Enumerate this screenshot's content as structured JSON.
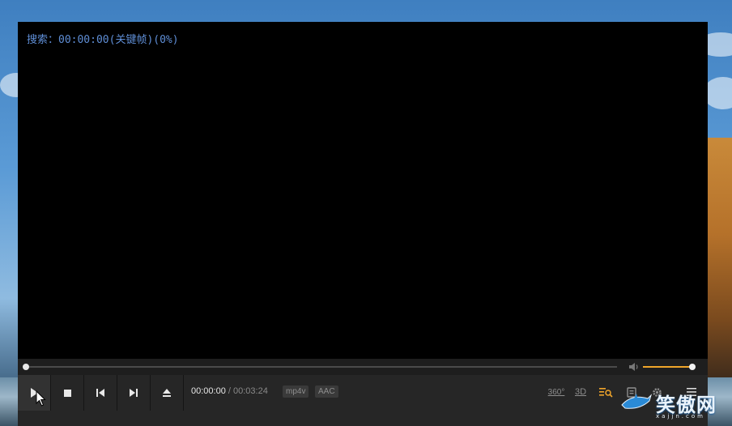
{
  "player": {
    "osd_text": "搜索：00:00:00(关键帧)(0%)",
    "seek_progress": 0,
    "volume_level": 0.96,
    "time_current": "00:00:00",
    "time_separator": "/",
    "time_total": "00:03:24",
    "tags": {
      "video_codec": "mp4v",
      "audio_codec": "AAC"
    },
    "buttons": {
      "play": "play-icon",
      "stop": "stop-icon",
      "previous": "skip-previous-icon",
      "next": "skip-next-icon",
      "eject": "eject-icon"
    },
    "right_tools": {
      "vr360_label": "360°",
      "threed_label": "3D",
      "search_frame": "frame-search-icon",
      "subtitle": "subtitle-icon",
      "settings": "gear-icon",
      "menu": "hamburger-menu-icon"
    },
    "accent_color": "#f0a52a",
    "osd_color": "#5f8ed6"
  },
  "watermark": {
    "text": "笑傲网",
    "subtext": "xajjn.com"
  }
}
